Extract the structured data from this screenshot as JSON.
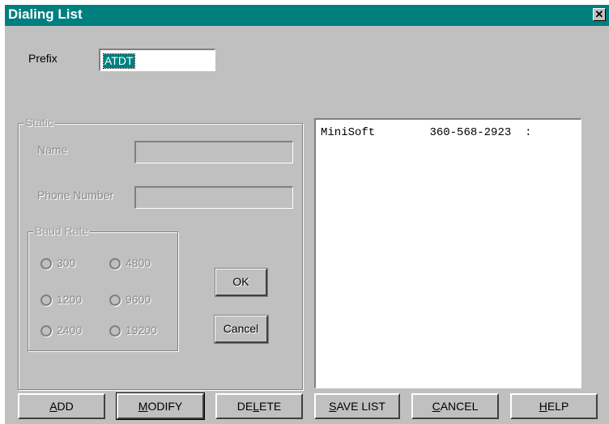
{
  "window": {
    "title": "Dialing List",
    "close_glyph": "✕"
  },
  "prefix": {
    "label": "Prefix",
    "value": "ATDT"
  },
  "static_group": {
    "legend": "Static",
    "name_label": "Name",
    "name_value": "",
    "phone_label": "Phone Number",
    "phone_value": ""
  },
  "baud_group": {
    "legend": "Baud Rate",
    "options": [
      "300",
      "4800",
      "1200",
      "9600",
      "2400",
      "19200"
    ]
  },
  "static_buttons": {
    "ok": "OK",
    "cancel": "Cancel"
  },
  "list": {
    "items": [
      {
        "name": "MiniSoft",
        "phone": "360-568-2923"
      }
    ]
  },
  "buttons": {
    "add": {
      "mnemonic": "A",
      "rest": "DD"
    },
    "modify": {
      "mnemonic": "M",
      "rest": "ODIFY"
    },
    "delete": {
      "pre": "DE",
      "mnemonic": "L",
      "rest": "ETE"
    },
    "save": {
      "mnemonic": "S",
      "rest": "AVE LIST"
    },
    "cancel": {
      "mnemonic": "C",
      "rest": "ANCEL"
    },
    "help": {
      "mnemonic": "H",
      "rest": "ELP"
    }
  },
  "colors": {
    "titlebar": "#007f7f",
    "face": "#c0c0c0",
    "selection": "#007f7f"
  }
}
